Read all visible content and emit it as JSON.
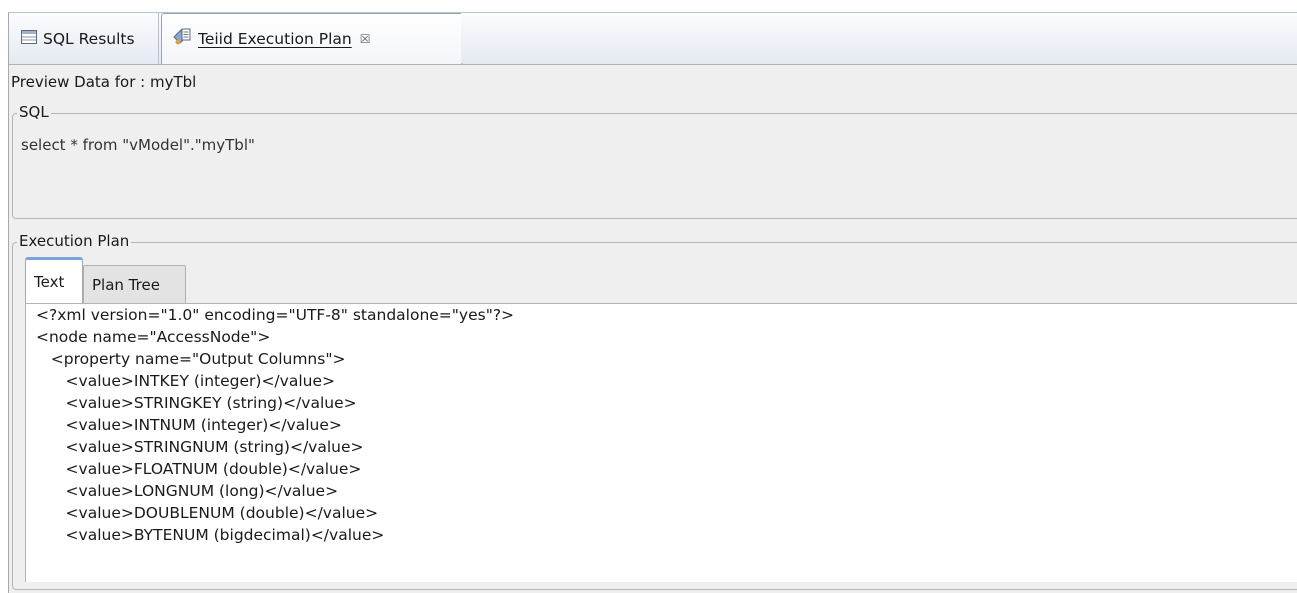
{
  "tabs": {
    "sql_results": "SQL Results",
    "execution_plan": "Teiid Execution Plan",
    "close_glyph": "☒"
  },
  "preview": {
    "title": "Preview Data for : myTbl"
  },
  "sql_group": {
    "legend": "SQL",
    "query": "select * from \"vModel\".\"myTbl\""
  },
  "plan_group": {
    "legend": "Execution Plan",
    "tabs": [
      "Text",
      "Plan Tree"
    ],
    "selected_tab": "Text",
    "lines": [
      "<?xml version=\"1.0\" encoding=\"UTF-8\" standalone=\"yes\"?>",
      "<node name=\"AccessNode\">",
      "   <property name=\"Output Columns\">",
      "      <value>INTKEY (integer)</value>",
      "      <value>STRINGKEY (string)</value>",
      "      <value>INTNUM (integer)</value>",
      "      <value>STRINGNUM (string)</value>",
      "      <value>FLOATNUM (double)</value>",
      "      <value>LONGNUM (long)</value>",
      "      <value>DOUBLENUM (double)</value>",
      "      <value>BYTENUM (bigdecimal)</value>"
    ]
  },
  "colors": {
    "tab_active_accent": "#7ba3d6",
    "panel_bg": "#efefef",
    "tabbar_bg": "#e4e9f1"
  },
  "icons": {
    "sql_results": "table-icon",
    "execution_plan": "plan-document-icon",
    "close": "close-icon"
  }
}
